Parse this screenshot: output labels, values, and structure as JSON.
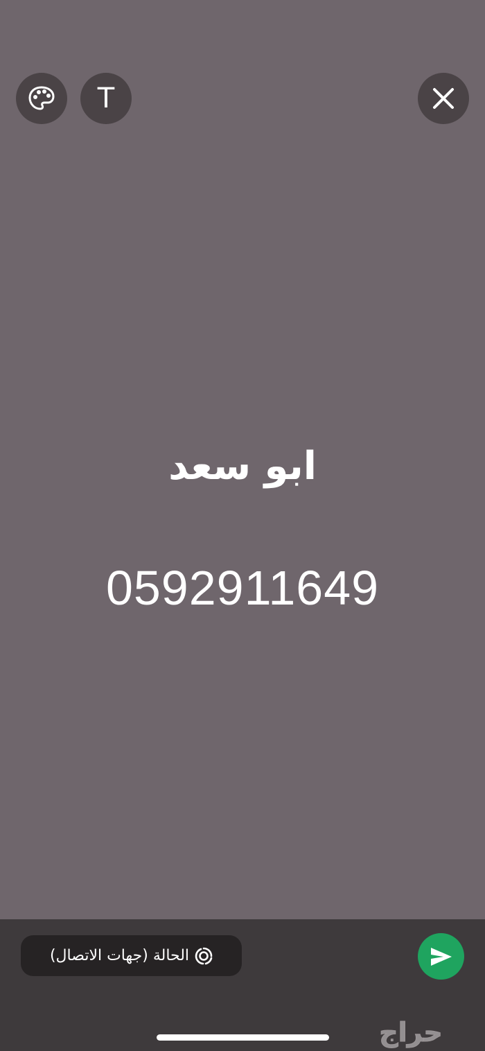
{
  "toolbar": {
    "palette_icon": "palette-icon",
    "text_button_label": "T",
    "close_icon": "close-icon"
  },
  "status": {
    "name": "ابو سعد",
    "phone": "0592911649",
    "background_color": "#6f666c"
  },
  "footer": {
    "audience_label": "الحالة (جهات الاتصال)",
    "audience_icon": "status-ring-icon",
    "send_icon": "send-icon",
    "send_color": "#1fa45f"
  },
  "watermark": {
    "text": "حراج"
  }
}
